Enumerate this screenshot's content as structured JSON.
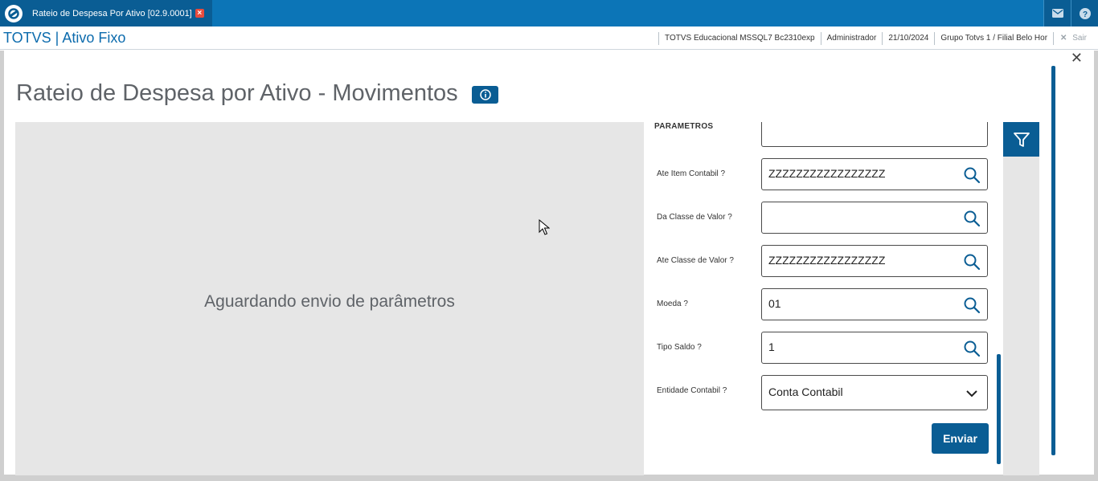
{
  "topbar": {
    "tab_label": "Rateio de Despesa Por Ativo [02.9.0001]",
    "mail_icon": "mail-icon",
    "help_icon": "help-icon"
  },
  "header": {
    "app_title": "TOTVS | Ativo Fixo",
    "environment": "TOTVS Educacional MSSQL7 Bc2310exp",
    "user": "Administrador",
    "date": "21/10/2024",
    "company": "Grupo Totvs 1 / Filial Belo Hor",
    "exit_label": "Sair"
  },
  "page": {
    "title": "Rateio de Despesa por Ativo - Movimentos",
    "preview_message": "Aguardando envio de parâmetros"
  },
  "params": {
    "title": "PARAMETROS",
    "fields": [
      {
        "label": "Ate Item Contabil ?",
        "value": "ZZZZZZZZZZZZZZZZZ",
        "icon": "search-icon"
      },
      {
        "label": "Da Classe de Valor ?",
        "value": "",
        "icon": "search-icon"
      },
      {
        "label": "Ate Classe de Valor ?",
        "value": "ZZZZZZZZZZZZZZZZZ",
        "icon": "search-icon"
      },
      {
        "label": "Moeda ?",
        "value": "01",
        "icon": "search-icon"
      },
      {
        "label": "Tipo Saldo ?",
        "value": "1",
        "icon": "search-icon"
      },
      {
        "label": "Entidade Contabil ?",
        "value": "Conta Contabil",
        "icon": "chevron-down-icon"
      }
    ],
    "submit_label": "Enviar"
  },
  "colors": {
    "primary": "#0a5d94",
    "topbar": "#0c75b7",
    "preview_bg": "#e6e6e6"
  }
}
